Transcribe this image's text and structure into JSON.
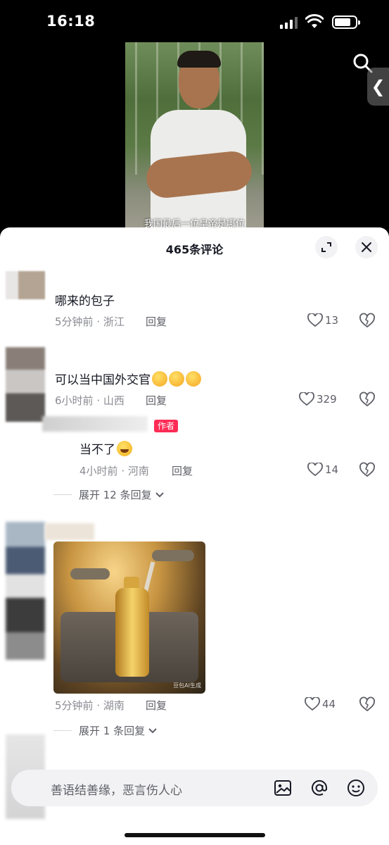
{
  "status_bar": {
    "time": "16:18"
  },
  "video": {
    "caption": "我国最后一位皇帝是哪位"
  },
  "panel": {
    "title": "465条评论"
  },
  "comments": [
    {
      "text": "哪来的包子",
      "time": "5分钟前",
      "location": "浙江",
      "reply_label": "回复",
      "likes": "13"
    },
    {
      "text": "可以当中国外交官",
      "time": "6小时前",
      "location": "山西",
      "reply_label": "回复",
      "likes": "329",
      "replies": [
        {
          "badge": "作者",
          "text": "当不了",
          "time": "4小时前",
          "location": "河南",
          "reply_label": "回复",
          "likes": "14"
        }
      ],
      "expand_label": "展开 12 条回复"
    },
    {
      "image_watermark": "豆包AI生成",
      "time": "5分钟前",
      "location": "湖南",
      "reply_label": "回复",
      "likes": "44",
      "expand_label": "展开 1 条回复"
    }
  ],
  "input": {
    "placeholder": "善语结善缘，恶言伤人心"
  },
  "colors": {
    "accent": "#fe2c55",
    "text_primary": "#161823",
    "text_secondary": "#8a8b91"
  }
}
